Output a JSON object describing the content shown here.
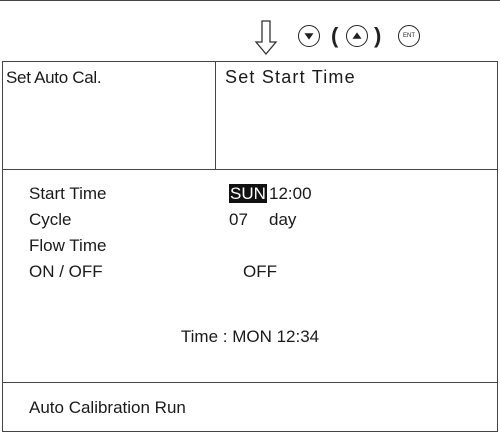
{
  "nav": {
    "enter_key_label": "ENT",
    "paren_open": "(",
    "paren_close": ")"
  },
  "header": {
    "mode": "Set Auto Cal.",
    "title": "Set Start Time"
  },
  "settings": {
    "start_time_label": "Start Time",
    "start_day": "SUN",
    "start_hour": "12:00",
    "cycle_label": "Cycle",
    "cycle_value": "07",
    "cycle_unit": "day",
    "flow_time_label": "Flow Time",
    "onoff_label": "ON / OFF",
    "onoff_value": "OFF"
  },
  "clock": {
    "text": "Time : MON 12:34"
  },
  "footer": {
    "status": "Auto Calibration Run"
  }
}
